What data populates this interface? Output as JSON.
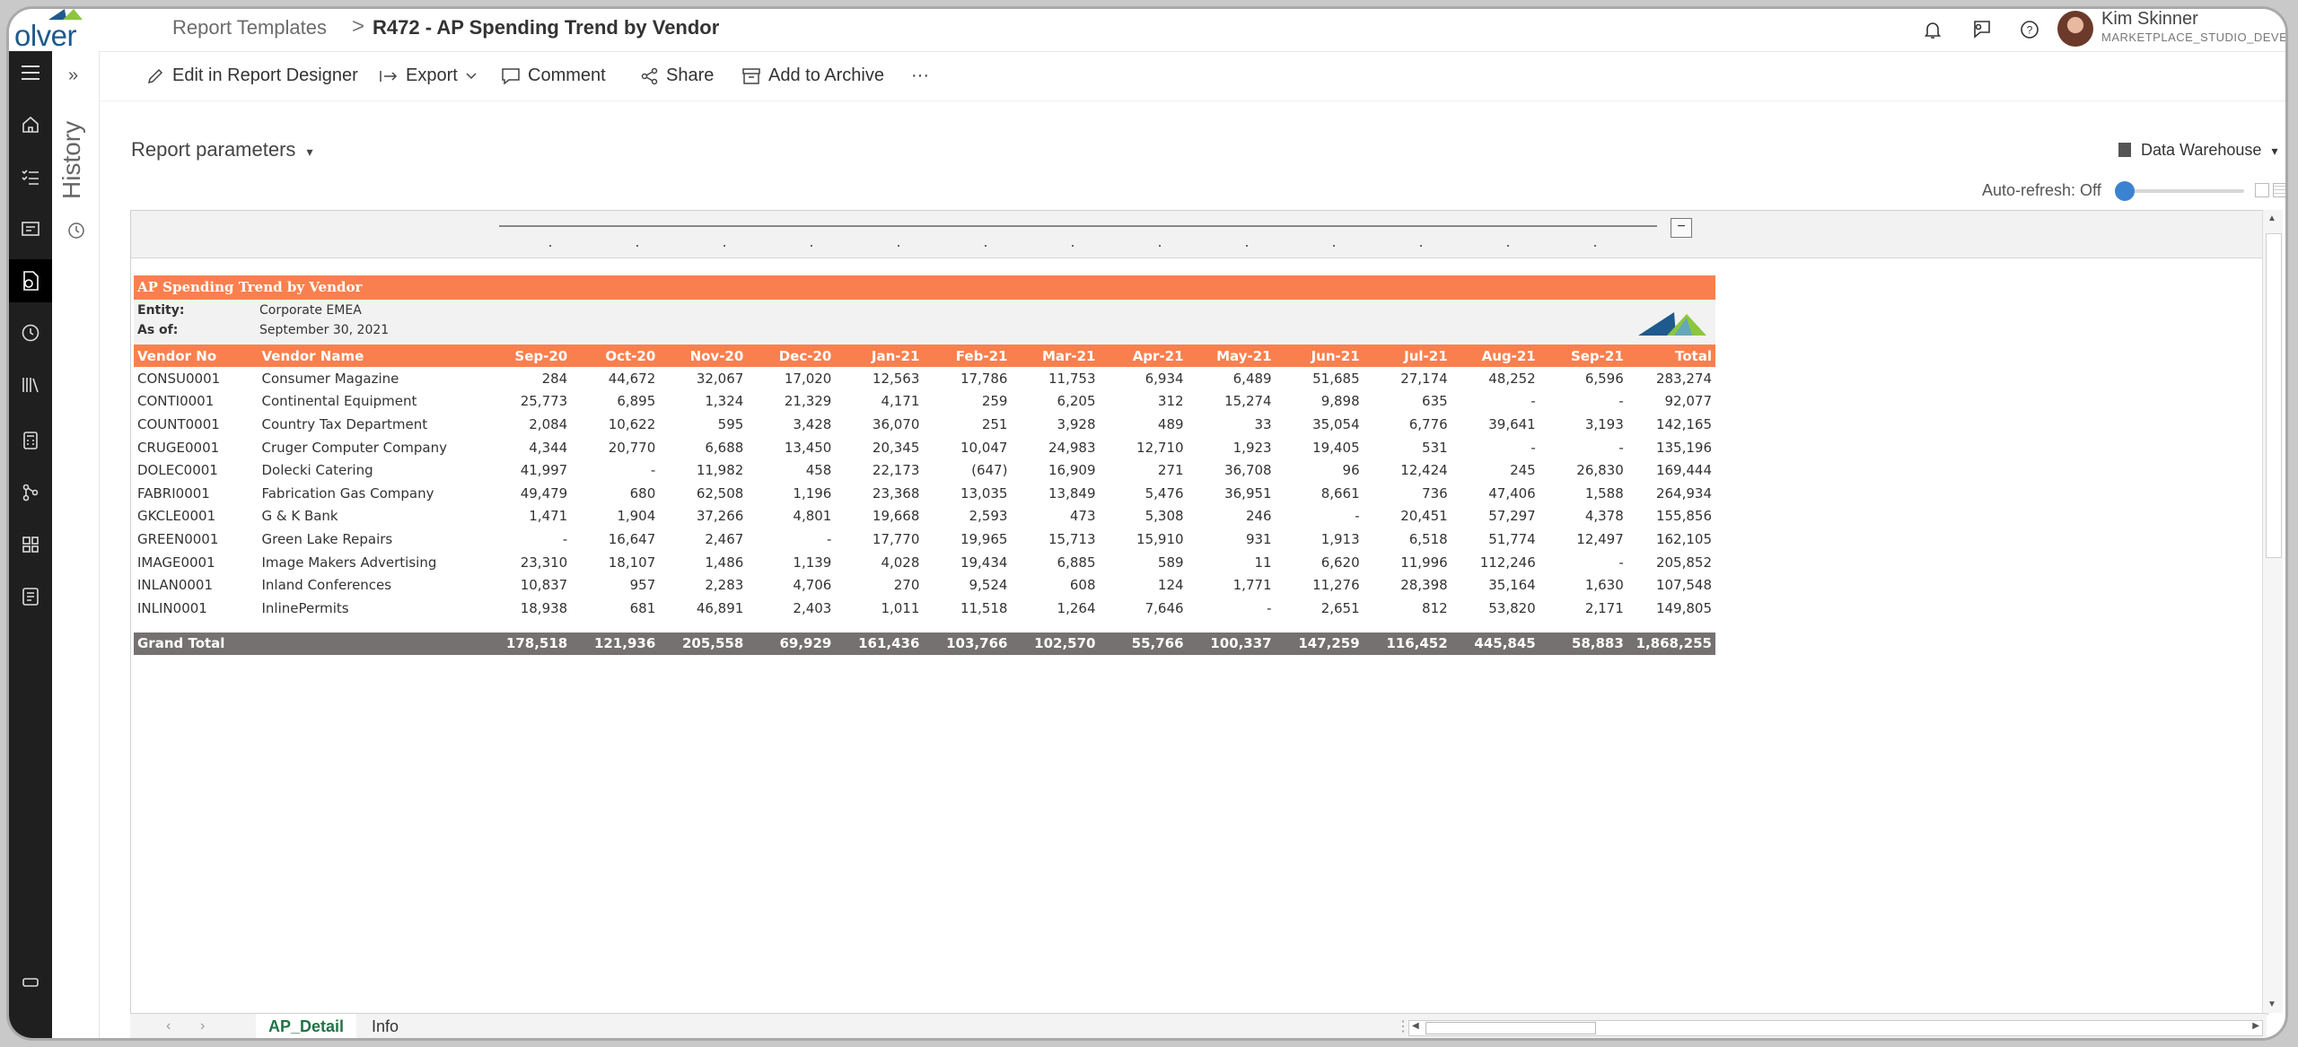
{
  "app": {
    "logo_text": "olver",
    "brand_color": "#1e5a8e"
  },
  "breadcrumb": {
    "parent": "Report Templates",
    "separator": ">",
    "current": "R472 - AP Spending Trend by Vendor"
  },
  "user": {
    "name": "Kim Skinner",
    "role": "MARKETPLACE_STUDIO_DEVELOPM"
  },
  "history": {
    "label": "History"
  },
  "toolbar": {
    "edit": "Edit in Report Designer",
    "export": "Export",
    "comment": "Comment",
    "share": "Share",
    "archive": "Add to Archive",
    "more": "···"
  },
  "params": {
    "label": "Report parameters"
  },
  "datasource": {
    "label": "Data Warehouse"
  },
  "autorefresh": {
    "label": "Auto-refresh: Off",
    "enabled": false
  },
  "report": {
    "title": "AP Spending Trend by Vendor",
    "entity_label": "Entity:",
    "entity_value": "Corporate EMEA",
    "asof_label": "As of:",
    "asof_value": "September 30, 2021",
    "accent_color": "#f9804e",
    "total_color": "#767171",
    "columns": [
      "Vendor No",
      "Vendor Name",
      "Sep-20",
      "Oct-20",
      "Nov-20",
      "Dec-20",
      "Jan-21",
      "Feb-21",
      "Mar-21",
      "Apr-21",
      "May-21",
      "Jun-21",
      "Jul-21",
      "Aug-21",
      "Sep-21",
      "Total"
    ],
    "rows": [
      [
        "CONSU0001",
        "Consumer Magazine",
        "284",
        "44,672",
        "32,067",
        "17,020",
        "12,563",
        "17,786",
        "11,753",
        "6,934",
        "6,489",
        "51,685",
        "27,174",
        "48,252",
        "6,596",
        "283,274"
      ],
      [
        "CONTI0001",
        "Continental Equipment",
        "25,773",
        "6,895",
        "1,324",
        "21,329",
        "4,171",
        "259",
        "6,205",
        "312",
        "15,274",
        "9,898",
        "635",
        "-",
        "-",
        "92,077"
      ],
      [
        "COUNT0001",
        "Country Tax Department",
        "2,084",
        "10,622",
        "595",
        "3,428",
        "36,070",
        "251",
        "3,928",
        "489",
        "33",
        "35,054",
        "6,776",
        "39,641",
        "3,193",
        "142,165"
      ],
      [
        "CRUGE0001",
        "Cruger Computer Company",
        "4,344",
        "20,770",
        "6,688",
        "13,450",
        "20,345",
        "10,047",
        "24,983",
        "12,710",
        "1,923",
        "19,405",
        "531",
        "-",
        "-",
        "135,196"
      ],
      [
        "DOLEC0001",
        "Dolecki Catering",
        "41,997",
        "-",
        "11,982",
        "458",
        "22,173",
        "(647)",
        "16,909",
        "271",
        "36,708",
        "96",
        "12,424",
        "245",
        "26,830",
        "169,444"
      ],
      [
        "FABRI0001",
        "Fabrication Gas Company",
        "49,479",
        "680",
        "62,508",
        "1,196",
        "23,368",
        "13,035",
        "13,849",
        "5,476",
        "36,951",
        "8,661",
        "736",
        "47,406",
        "1,588",
        "264,934"
      ],
      [
        "GKCLE0001",
        "G & K Bank",
        "1,471",
        "1,904",
        "37,266",
        "4,801",
        "19,668",
        "2,593",
        "473",
        "5,308",
        "246",
        "-",
        "20,451",
        "57,297",
        "4,378",
        "155,856"
      ],
      [
        "GREEN0001",
        "Green Lake Repairs",
        "-",
        "16,647",
        "2,467",
        "-",
        "17,770",
        "19,965",
        "15,713",
        "15,910",
        "931",
        "1,913",
        "6,518",
        "51,774",
        "12,497",
        "162,105"
      ],
      [
        "IMAGE0001",
        "Image Makers Advertising",
        "23,310",
        "18,107",
        "1,486",
        "1,139",
        "4,028",
        "19,434",
        "6,885",
        "589",
        "11",
        "6,620",
        "11,996",
        "112,246",
        "-",
        "205,852"
      ],
      [
        "INLAN0001",
        "Inland Conferences",
        "10,837",
        "957",
        "2,283",
        "4,706",
        "270",
        "9,524",
        "608",
        "124",
        "1,771",
        "11,276",
        "28,398",
        "35,164",
        "1,630",
        "107,548"
      ],
      [
        "INLIN0001",
        "InlinePermits",
        "18,938",
        "681",
        "46,891",
        "2,403",
        "1,011",
        "11,518",
        "1,264",
        "7,646",
        "-",
        "2,651",
        "812",
        "53,820",
        "2,171",
        "149,805"
      ]
    ],
    "grand_total": [
      "Grand Total",
      "",
      "178,518",
      "121,936",
      "205,558",
      "69,929",
      "161,436",
      "103,766",
      "102,570",
      "55,766",
      "100,337",
      "147,259",
      "116,452",
      "445,845",
      "58,883",
      "1,868,255"
    ]
  },
  "sheet_tabs": [
    {
      "label": "AP_Detail",
      "active": true
    },
    {
      "label": "Info",
      "active": false
    }
  ]
}
